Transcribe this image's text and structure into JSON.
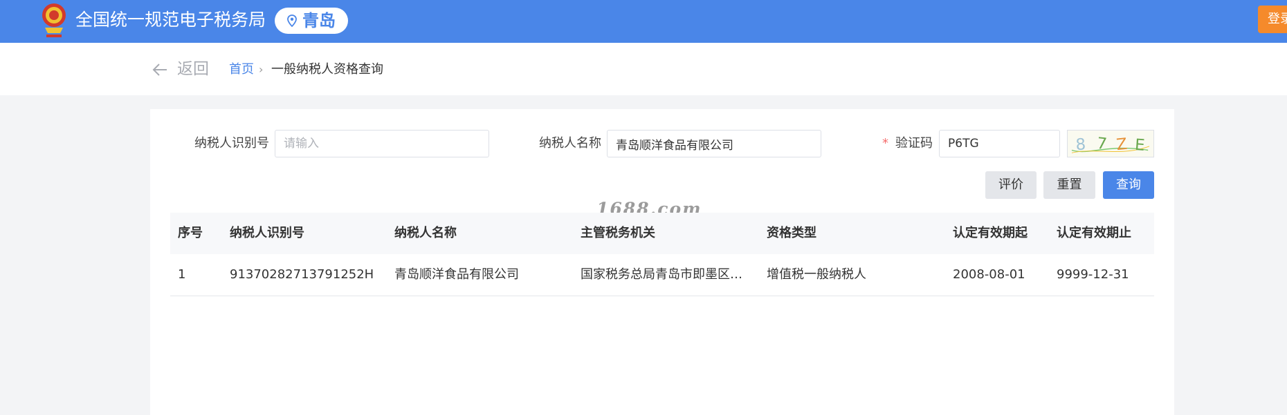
{
  "header": {
    "site_title": "全国统一规范电子税务局",
    "city": "青岛",
    "login_label": "登录",
    "bar_color": "#4a86e8"
  },
  "breadcrumb": {
    "back_label": "返回",
    "home_label": "首页",
    "separator": "›",
    "current_label": "一般纳税人资格查询"
  },
  "form": {
    "taxpayer_id_label": "纳税人识别号",
    "taxpayer_id_value": "",
    "taxpayer_id_placeholder": "请输入",
    "taxpayer_name_label": "纳税人名称",
    "taxpayer_name_value": "青岛顺洋食品有限公司",
    "captcha_label": "验证码",
    "required_mark": "*",
    "captcha_value": "P6TG",
    "captcha_image_text": "87ZE"
  },
  "actions": {
    "evaluate_label": "评价",
    "reset_label": "重置",
    "query_label": "查询"
  },
  "watermark": "1688.com",
  "table": {
    "headers": [
      "序号",
      "纳税人识别号",
      "纳税人名称",
      "主管税务机关",
      "资格类型",
      "认定有效期起",
      "认定有效期止"
    ],
    "rows": [
      [
        "1",
        "91370282713791252H",
        "青岛顺洋食品有限公司",
        "国家税务总局青岛市即墨区税...",
        "增值税一般纳税人",
        "2008-08-01",
        "9999-12-31"
      ]
    ]
  }
}
